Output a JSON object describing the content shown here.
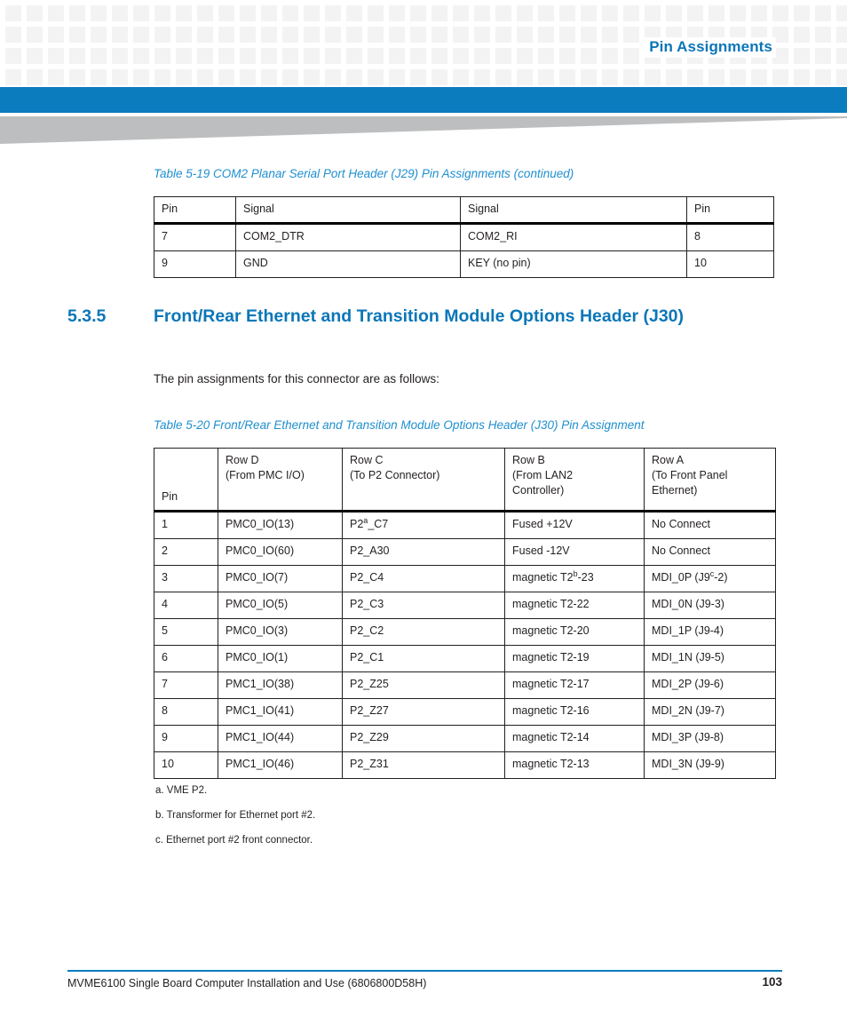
{
  "page": {
    "header_title": "Pin Assignments",
    "accent_blue": "#0b7cbd",
    "caption_blue": "#1f8fce",
    "heading_blue": "#0b76b8",
    "wedge_gray": "#bcbec0",
    "checker_gray": "#f3f3f3"
  },
  "table_5_19": {
    "caption": "Table 5-19 COM2 Planar Serial Port Header (J29) Pin Assignments (continued)",
    "headers": [
      "Pin",
      "Signal",
      "Signal",
      "Pin"
    ],
    "rows": [
      [
        "7",
        "COM2_DTR",
        "COM2_RI",
        "8"
      ],
      [
        "9",
        "GND",
        "KEY (no pin)",
        "10"
      ]
    ]
  },
  "section": {
    "number": "5.3.5",
    "title": "Front/Rear Ethernet and Transition Module Options Header (J30)",
    "paragraph": "The pin assignments for this connector are as follows:"
  },
  "table_5_20": {
    "caption": "Table 5-20 Front/Rear Ethernet and Transition Module Options Header (J30) Pin Assignment",
    "headers": [
      "Pin",
      "Row D\n(From PMC I/O)",
      "Row C\n(To P2 Connector)",
      "Row B\n(From LAN2 Controller)",
      "Row A\n(To Front Panel Ethernet)"
    ],
    "header_lines": {
      "pin": "Pin",
      "row_d": [
        "Row D",
        "(From PMC I/O)"
      ],
      "row_c": [
        "Row C",
        "(To P2 Connector)"
      ],
      "row_b": [
        "Row B",
        "(From LAN2",
        "Controller)"
      ],
      "row_a": [
        "Row A",
        "(To Front Panel",
        "Ethernet)"
      ]
    },
    "rows": [
      {
        "pin": "1",
        "row_d": "PMC0_IO(13)",
        "row_c": "P2_C7",
        "row_c_pre": "P2",
        "row_c_sup": "a",
        "row_c_post": "_C7",
        "row_b": "Fused +12V",
        "row_b_pre": "Fused +12V",
        "row_b_sup": "",
        "row_b_post": "",
        "row_a": "No Connect",
        "row_a_pre": "No Connect",
        "row_a_sup": "",
        "row_a_post": ""
      },
      {
        "pin": "2",
        "row_d": "PMC0_IO(60)",
        "row_c": "P2_A30",
        "row_c_pre": "P2_A30",
        "row_c_sup": "",
        "row_c_post": "",
        "row_b": "Fused -12V",
        "row_b_pre": "Fused -12V",
        "row_b_sup": "",
        "row_b_post": "",
        "row_a": "No Connect",
        "row_a_pre": "No Connect",
        "row_a_sup": "",
        "row_a_post": ""
      },
      {
        "pin": "3",
        "row_d": "PMC0_IO(7)",
        "row_c": "P2_C4",
        "row_c_pre": "P2_C4",
        "row_c_sup": "",
        "row_c_post": "",
        "row_b": "magnetic T2-23",
        "row_b_pre": "magnetic T2",
        "row_b_sup": "b",
        "row_b_post": "-23",
        "row_a": "MDI_0P (J9-2)",
        "row_a_pre": "MDI_0P (J9",
        "row_a_sup": "c",
        "row_a_post": "-2)"
      },
      {
        "pin": "4",
        "row_d": "PMC0_IO(5)",
        "row_c": "P2_C3",
        "row_c_pre": "P2_C3",
        "row_c_sup": "",
        "row_c_post": "",
        "row_b": "magnetic T2-22",
        "row_b_pre": "magnetic T2-22",
        "row_b_sup": "",
        "row_b_post": "",
        "row_a": "MDI_0N (J9-3)",
        "row_a_pre": "MDI_0N (J9-3)",
        "row_a_sup": "",
        "row_a_post": ""
      },
      {
        "pin": "5",
        "row_d": "PMC0_IO(3)",
        "row_c": "P2_C2",
        "row_c_pre": "P2_C2",
        "row_c_sup": "",
        "row_c_post": "",
        "row_b": "magnetic T2-20",
        "row_b_pre": "magnetic T2-20",
        "row_b_sup": "",
        "row_b_post": "",
        "row_a": "MDI_1P (J9-4)",
        "row_a_pre": "MDI_1P (J9-4)",
        "row_a_sup": "",
        "row_a_post": ""
      },
      {
        "pin": "6",
        "row_d": "PMC0_IO(1)",
        "row_c": "P2_C1",
        "row_c_pre": "P2_C1",
        "row_c_sup": "",
        "row_c_post": "",
        "row_b": "magnetic T2-19",
        "row_b_pre": "magnetic T2-19",
        "row_b_sup": "",
        "row_b_post": "",
        "row_a": "MDI_1N (J9-5)",
        "row_a_pre": "MDI_1N (J9-5)",
        "row_a_sup": "",
        "row_a_post": ""
      },
      {
        "pin": "7",
        "row_d": "PMC1_IO(38)",
        "row_c": "P2_Z25",
        "row_c_pre": "P2_Z25",
        "row_c_sup": "",
        "row_c_post": "",
        "row_b": "magnetic T2-17",
        "row_b_pre": "magnetic T2-17",
        "row_b_sup": "",
        "row_b_post": "",
        "row_a": "MDI_2P (J9-6)",
        "row_a_pre": "MDI_2P (J9-6)",
        "row_a_sup": "",
        "row_a_post": ""
      },
      {
        "pin": "8",
        "row_d": "PMC1_IO(41)",
        "row_c": "P2_Z27",
        "row_c_pre": "P2_Z27",
        "row_c_sup": "",
        "row_c_post": "",
        "row_b": "magnetic T2-16",
        "row_b_pre": "magnetic T2-16",
        "row_b_sup": "",
        "row_b_post": "",
        "row_a": "MDI_2N (J9-7)",
        "row_a_pre": "MDI_2N (J9-7)",
        "row_a_sup": "",
        "row_a_post": ""
      },
      {
        "pin": "9",
        "row_d": "PMC1_IO(44)",
        "row_c": "P2_Z29",
        "row_c_pre": "P2_Z29",
        "row_c_sup": "",
        "row_c_post": "",
        "row_b": "magnetic T2-14",
        "row_b_pre": "magnetic T2-14",
        "row_b_sup": "",
        "row_b_post": "",
        "row_a": "MDI_3P (J9-8)",
        "row_a_pre": "MDI_3P (J9-8)",
        "row_a_sup": "",
        "row_a_post": ""
      },
      {
        "pin": "10",
        "row_d": "PMC1_IO(46)",
        "row_c": "P2_Z31",
        "row_c_pre": "P2_Z31",
        "row_c_sup": "",
        "row_c_post": "",
        "row_b": "magnetic T2-13",
        "row_b_pre": "magnetic T2-13",
        "row_b_sup": "",
        "row_b_post": "",
        "row_a": "MDI_3N (J9-9)",
        "row_a_pre": "MDI_3N (J9-9)",
        "row_a_sup": "",
        "row_a_post": ""
      }
    ]
  },
  "footnotes": [
    "a. VME P2.",
    "b. Transformer for Ethernet port #2.",
    "c. Ethernet port #2 front connector."
  ],
  "footer": {
    "document_title": "MVME6100 Single Board Computer Installation and Use (6806800D58H)",
    "page_number": "103"
  }
}
